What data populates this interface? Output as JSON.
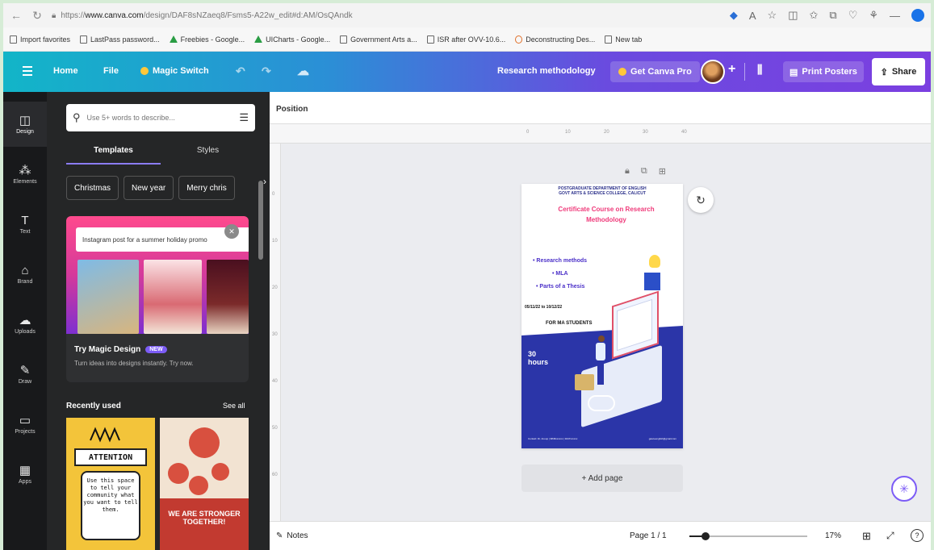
{
  "browser": {
    "url_prefix": "https://",
    "url_domain": "www.canva.com",
    "url_path": "/design/DAF8sNZaeq8/Fsms5-A22w_edit#d:AM/OsQAndk",
    "bookmarks": [
      {
        "label": "Import favorites",
        "icon": "folder-icon"
      },
      {
        "label": "LastPass password...",
        "icon": "page-icon"
      },
      {
        "label": "Freebies - Google...",
        "icon": "drive-icon"
      },
      {
        "label": "UICharts - Google...",
        "icon": "drive-icon"
      },
      {
        "label": "Government Arts a...",
        "icon": "page-icon"
      },
      {
        "label": "ISR after OVV-10.6...",
        "icon": "page-icon"
      },
      {
        "label": "Deconstructing Des...",
        "icon": "record-icon"
      },
      {
        "label": "New tab",
        "icon": "tab-icon"
      }
    ]
  },
  "topbar": {
    "home": "Home",
    "file": "File",
    "magic_switch": "Magic Switch",
    "doc_title": "Research methodology",
    "get_pro": "Get Canva Pro",
    "print": "Print Posters",
    "share": "Share"
  },
  "rail": [
    {
      "label": "Design",
      "icon": "design-icon",
      "glyph": "◫"
    },
    {
      "label": "Elements",
      "icon": "elements-icon",
      "glyph": "⁂"
    },
    {
      "label": "Text",
      "icon": "text-icon",
      "glyph": "T"
    },
    {
      "label": "Brand",
      "icon": "brand-icon",
      "glyph": "⌂"
    },
    {
      "label": "Uploads",
      "icon": "uploads-icon",
      "glyph": "☁"
    },
    {
      "label": "Draw",
      "icon": "draw-icon",
      "glyph": "✎"
    },
    {
      "label": "Projects",
      "icon": "projects-icon",
      "glyph": "▭"
    },
    {
      "label": "Apps",
      "icon": "apps-icon",
      "glyph": "▦"
    }
  ],
  "panel": {
    "search_placeholder": "Use 5+ words to describe...",
    "tabs": [
      "Templates",
      "Styles"
    ],
    "chips": [
      "Christmas",
      "New year",
      "Merry chris"
    ],
    "magic_input": "Instagram post for a summer holiday promo",
    "magic_title": "Try Magic Design",
    "new_badge": "NEW",
    "magic_sub": "Turn ideas into designs instantly. Try now.",
    "recently_used": "Recently used",
    "see_all": "See all",
    "tpl1_heading": "ATTENTION",
    "tpl1_body": "Use this space to tell your community what you want to tell them.",
    "tpl2_text": "WE ARE STRONGER TOGETHER!"
  },
  "canvas": {
    "position_label": "Position",
    "ruler_top": [
      "0",
      "10",
      "20",
      "30",
      "40"
    ],
    "ruler_left": [
      "0",
      "10",
      "20",
      "30",
      "40",
      "50",
      "60"
    ],
    "add_page": "+ Add page"
  },
  "poster": {
    "dept": "POSTGRADUATE DEPARTMENT OF ENGLISH\nGOVT ARTS & SCIENCE COLLEGE, CALICUT",
    "course": "Certificate Course on Research Methodology",
    "topics": [
      "• Research methods",
      "• MLA",
      "• Parts of a Thesis"
    ],
    "dates": "05/11/22 to 10/12/22",
    "for": "FOR MA STUDENTS",
    "hours": "30 hours",
    "footer_left": "Contact: Dr. Anoop | 9846xxxxxx | 9447xxxxxx",
    "footer_right": "gasceenglish@gmail.com"
  },
  "bottom": {
    "notes": "Notes",
    "page": "Page 1 / 1",
    "zoom": "17%",
    "zoom_level": 0.14
  }
}
